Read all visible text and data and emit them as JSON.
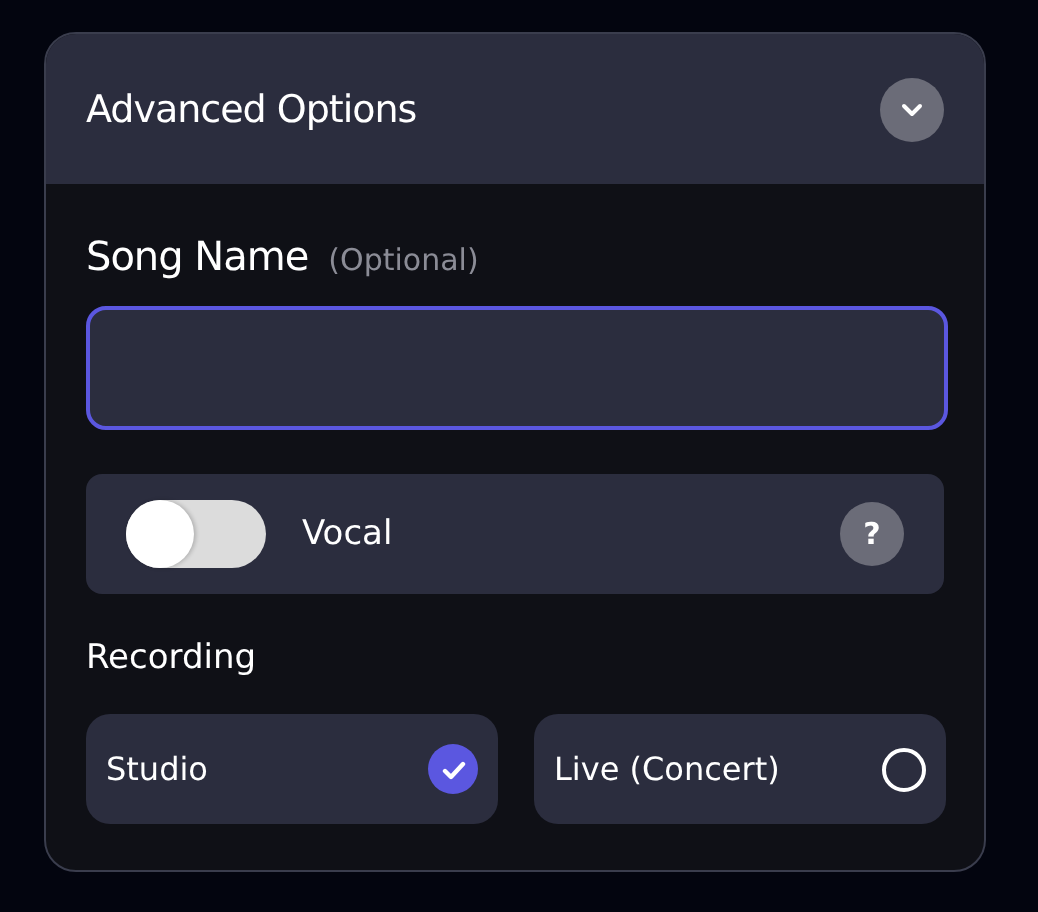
{
  "panel": {
    "title": "Advanced Options",
    "expanded": true
  },
  "song_name": {
    "label": "Song Name",
    "hint": "(Optional)",
    "focused": true
  },
  "vocal": {
    "label": "Vocal",
    "on": false,
    "help": "?"
  },
  "recording": {
    "label": "Recording",
    "options": [
      {
        "label": "Studio",
        "selected": true
      },
      {
        "label": "Live (Concert)",
        "selected": false
      }
    ]
  }
}
